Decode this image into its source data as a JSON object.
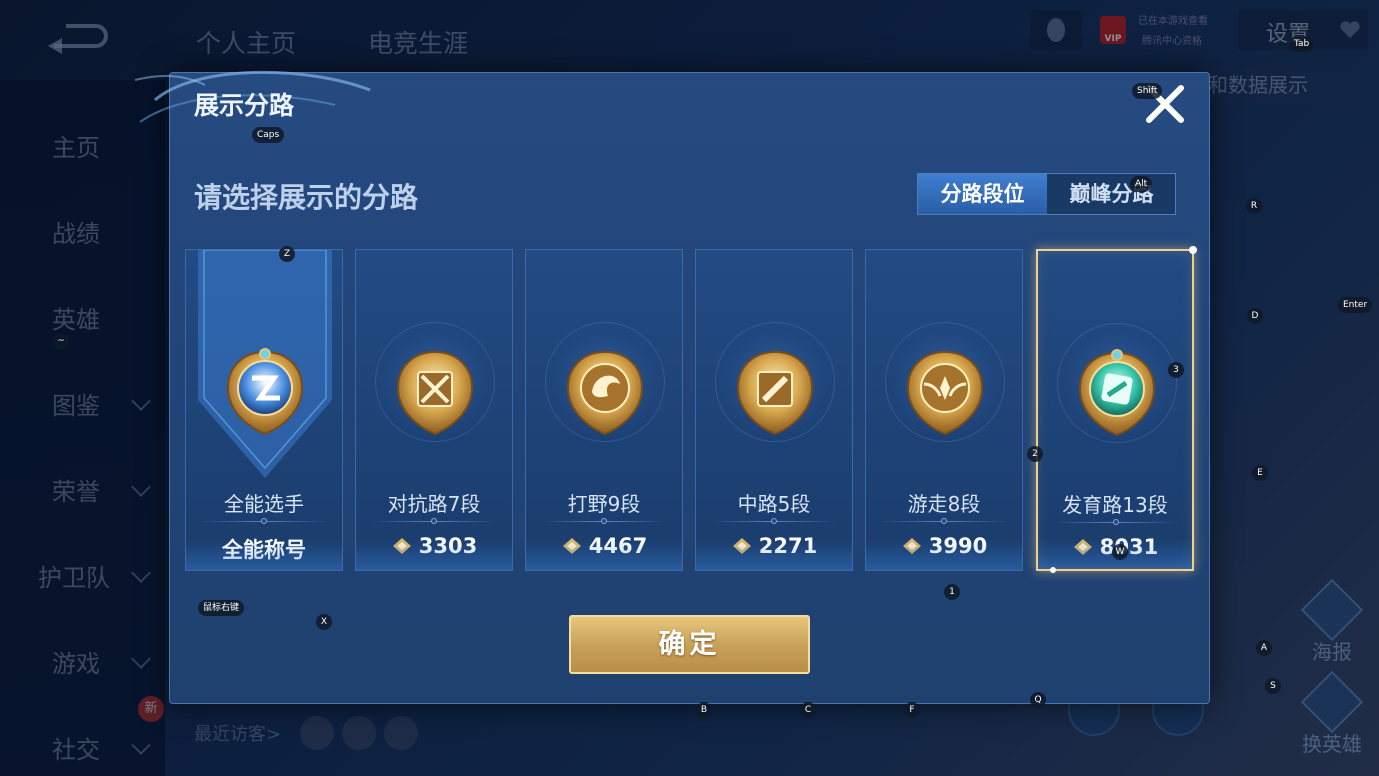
{
  "background": {
    "tabs": [
      "个人主页",
      "电竞生涯"
    ],
    "vip": {
      "badge": "VIP",
      "line1": "已在本游戏查看",
      "line2": "腾讯中心资格"
    },
    "settings_label": "设置",
    "showcase_button": "和数据展示",
    "sidebar": [
      {
        "label": "主页",
        "chevron": false
      },
      {
        "label": "战绩",
        "chevron": false
      },
      {
        "label": "英雄",
        "chevron": false
      },
      {
        "label": "图鉴",
        "chevron": true
      },
      {
        "label": "荣誉",
        "chevron": true
      },
      {
        "label": "护卫队",
        "chevron": true
      },
      {
        "label": "游戏",
        "chevron": true
      },
      {
        "label": "社交",
        "chevron": true
      }
    ],
    "new_badge": "新",
    "recent_visitors": "最近访客>",
    "right_buttons": [
      "海报",
      "换英雄"
    ]
  },
  "dialog": {
    "title": "展示分路",
    "subtitle": "请选择展示的分路",
    "segments": [
      {
        "label": "分路段位",
        "active": true
      },
      {
        "label": "巅峰分路",
        "active": false
      }
    ],
    "cards": [
      {
        "name": "全能选手",
        "score": "全能称号",
        "show_points": false,
        "emblem": "all-round",
        "selected": false
      },
      {
        "name": "对抗路7段",
        "score": "3303",
        "show_points": true,
        "emblem": "clash-lane",
        "selected": false
      },
      {
        "name": "打野9段",
        "score": "4467",
        "show_points": true,
        "emblem": "jungle",
        "selected": false
      },
      {
        "name": "中路5段",
        "score": "2271",
        "show_points": true,
        "emblem": "mid-lane",
        "selected": false
      },
      {
        "name": "游走8段",
        "score": "3990",
        "show_points": true,
        "emblem": "roam",
        "selected": false
      },
      {
        "name": "发育路13段",
        "score": "8031",
        "show_points": true,
        "emblem": "farm-lane",
        "selected": true
      }
    ],
    "confirm": "确定"
  },
  "key_hints": [
    "Caps",
    "Shift",
    "Tab",
    "Alt",
    "Z",
    "R",
    "Enter",
    "D",
    "~",
    "3",
    "2",
    "E",
    "1",
    "W",
    "鼠标右键",
    "X",
    "A",
    "S",
    "B",
    "C",
    "F",
    "Q"
  ],
  "colors": {
    "accent_gold": "#f0cf8a",
    "active_segment": "#3f7ed0",
    "dialog_bg": "#22457a"
  }
}
